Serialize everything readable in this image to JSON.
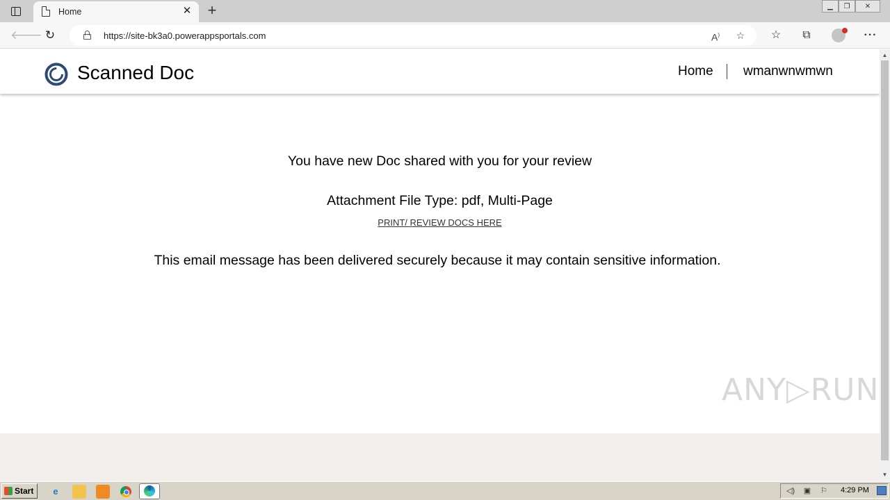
{
  "browser": {
    "tab_title": "Home",
    "tab_close": "✕",
    "new_tab": "+",
    "url": "https://site-bk3a0.powerappsportals.com",
    "window_controls": {
      "minimize": "▁",
      "restore": "❐",
      "close": "✕"
    }
  },
  "site": {
    "title": "Scanned Doc",
    "logo_color": "#2d4a73",
    "nav": {
      "home": "Home",
      "user": "wmanwnwmwn"
    }
  },
  "content": {
    "line1": "You have new Doc shared with you for your review",
    "line2": "Attachment File Type: pdf, Multi-Page",
    "link": "PRINT/ REVIEW DOCS HERE",
    "line3": "This email message has been delivered securely because it may contain sensitive information."
  },
  "watermark": "ANY▷RUN",
  "taskbar": {
    "start_label": "Start",
    "clock": "4:29 PM",
    "apps": [
      "internet-explorer-icon",
      "file-explorer-icon",
      "media-player-icon",
      "chrome-icon",
      "edge-icon"
    ]
  }
}
